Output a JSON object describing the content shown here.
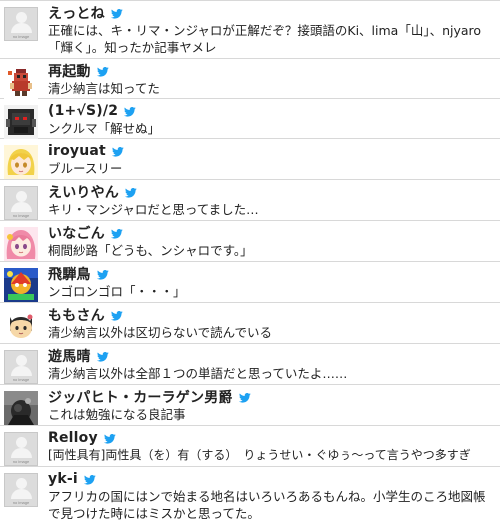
{
  "colors": {
    "twitter_bird": "#1da1f2",
    "divider": "#d8d8d8",
    "text": "#222222"
  },
  "placeholder_text": "no image",
  "tweets": [
    {
      "name": "えっとね",
      "text": "正確には、キ・リマ・ンジャロが正解だぞ？接頭語のKi、lima「山」、njyaro「輝く」。知ったか記事ヤメレ",
      "avatar": "noimage"
    },
    {
      "name": "再起動",
      "text": "清少納言は知ってた",
      "avatar": "pixel-character-red"
    },
    {
      "name": "(1+√S)/2",
      "text": "ンクルマ「解せぬ」",
      "avatar": "robot-red-eyes"
    },
    {
      "name": "iroyuat",
      "text": "ブルースリー",
      "avatar": "anime-girl-yellow"
    },
    {
      "name": "えいりやん",
      "text": "キリ・マンジャロだと思ってました…",
      "avatar": "noimage"
    },
    {
      "name": "いなごん",
      "text": "桐間紗路「どうも、ンシャロです。」",
      "avatar": "anime-girl-pink"
    },
    {
      "name": "飛騨鳥",
      "text": "ンゴロンゴロ「・・・」",
      "avatar": "colorful-art"
    },
    {
      "name": "ももさん",
      "text": "清少納言以外は区切らないで読んでいる",
      "avatar": "cat-face"
    },
    {
      "name": "遊馬晴",
      "text": "清少納言以外は全部１つの単語だと思っていたよ……",
      "avatar": "noimage"
    },
    {
      "name": "ジッパヒト・カーラゲン男爵",
      "text": "これは勉強になる良記事",
      "avatar": "dark-photo"
    },
    {
      "name": "Relloy",
      "text": "[両性具有]両性具（を）有（する）　りょうせい・ぐゆぅ～って言うやつ多すぎ",
      "avatar": "noimage"
    },
    {
      "name": "yk-i",
      "text": "アフリカの国にはンで始まる地名はいろいろあるもんね。小学生のころ地図帳で見つけた時にはミスかと思ってた。",
      "avatar": "noimage"
    }
  ]
}
